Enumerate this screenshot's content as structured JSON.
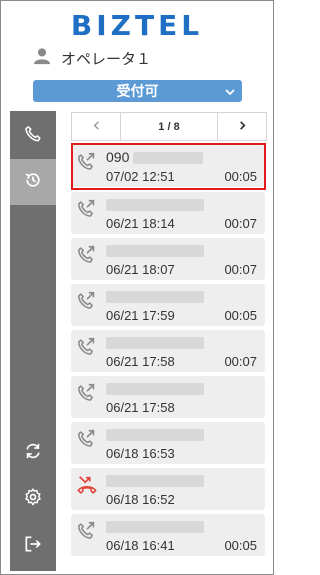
{
  "app": {
    "logo": "BIZTEL"
  },
  "user": {
    "name": "オペレータ１",
    "icon": "user-icon"
  },
  "status": {
    "label": "受付可",
    "icon": "chevron-down-icon"
  },
  "sidebar": {
    "items": [
      {
        "name": "phone",
        "icon": "phone-icon"
      },
      {
        "name": "history",
        "icon": "history-icon",
        "active": true
      },
      {
        "name": "refresh",
        "icon": "refresh-icon"
      },
      {
        "name": "settings",
        "icon": "gear-icon"
      },
      {
        "name": "logout",
        "icon": "logout-icon"
      }
    ]
  },
  "pager": {
    "prev": "‹",
    "page": "1 / 8",
    "next": "›"
  },
  "history": [
    {
      "number": "090",
      "datetime": "07/02 12:51",
      "duration": "00:05",
      "type": "outgoing"
    },
    {
      "number": "",
      "datetime": "06/21 18:14",
      "duration": "00:07",
      "type": "outgoing"
    },
    {
      "number": "",
      "datetime": "06/21 18:07",
      "duration": "00:07",
      "type": "outgoing"
    },
    {
      "number": "",
      "datetime": "06/21 17:59",
      "duration": "00:05",
      "type": "outgoing"
    },
    {
      "number": "",
      "datetime": "06/21 17:58",
      "duration": "00:07",
      "type": "outgoing"
    },
    {
      "number": "",
      "datetime": "06/21 17:58",
      "duration": "",
      "type": "outgoing"
    },
    {
      "number": "",
      "datetime": "06/18 16:53",
      "duration": "",
      "type": "outgoing"
    },
    {
      "number": "",
      "datetime": "06/18 16:52",
      "duration": "",
      "type": "missed"
    },
    {
      "number": "",
      "datetime": "06/18 16:41",
      "duration": "00:05",
      "type": "outgoing"
    }
  ],
  "colors": {
    "brand": "#1f6fc4",
    "status": "#5b9ad5",
    "sidebar": "#6f6f6f",
    "sidebar_active": "#a8a8a8",
    "item_bg": "#eeeeee",
    "highlight": "#e01b1b",
    "outgoing_icon": "#8a8a8a",
    "missed_icon": "#e0443a"
  }
}
